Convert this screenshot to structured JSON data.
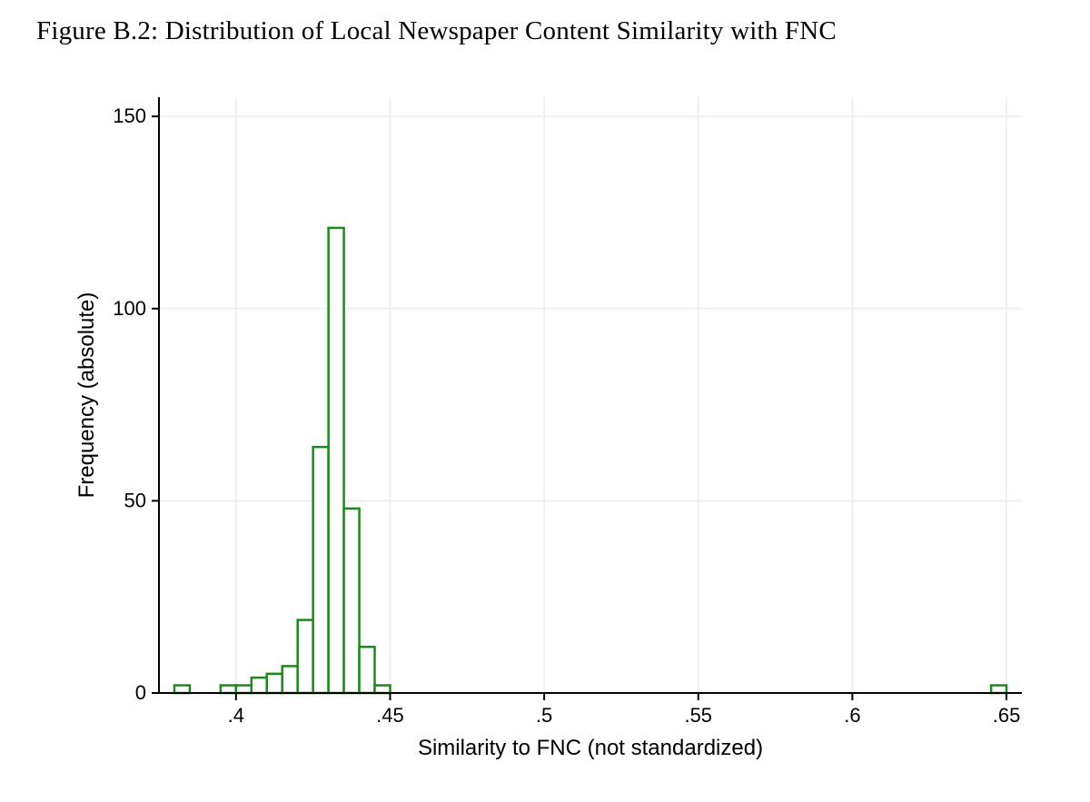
{
  "title": "Figure B.2: Distribution of Local Newspaper Content Similarity with FNC",
  "chart_data": {
    "type": "bar",
    "title": "",
    "xlabel": "Similarity to FNC (not standardized)",
    "ylabel": "Frequency (absolute)",
    "xlim": [
      0.375,
      0.655
    ],
    "ylim": [
      0,
      155
    ],
    "x_ticks": [
      0.4,
      0.45,
      0.5,
      0.55,
      0.6,
      0.65
    ],
    "x_tick_labels": [
      ".4",
      ".45",
      ".5",
      ".55",
      ".6",
      ".65"
    ],
    "y_ticks": [
      0,
      50,
      100,
      150
    ],
    "y_tick_labels": [
      "0",
      "50",
      "100",
      "150"
    ],
    "grid_x": [
      0.4,
      0.45,
      0.5,
      0.55,
      0.6,
      0.65
    ],
    "grid_y": [
      50,
      100,
      150
    ],
    "bin_width": 0.005,
    "bar_color": "#1a8a1a",
    "bars": [
      {
        "x": 0.38,
        "y": 2
      },
      {
        "x": 0.395,
        "y": 2
      },
      {
        "x": 0.4,
        "y": 2
      },
      {
        "x": 0.405,
        "y": 4
      },
      {
        "x": 0.41,
        "y": 5
      },
      {
        "x": 0.415,
        "y": 7
      },
      {
        "x": 0.42,
        "y": 19
      },
      {
        "x": 0.425,
        "y": 64
      },
      {
        "x": 0.43,
        "y": 121
      },
      {
        "x": 0.435,
        "y": 48
      },
      {
        "x": 0.44,
        "y": 12
      },
      {
        "x": 0.445,
        "y": 2
      },
      {
        "x": 0.645,
        "y": 2
      }
    ]
  }
}
